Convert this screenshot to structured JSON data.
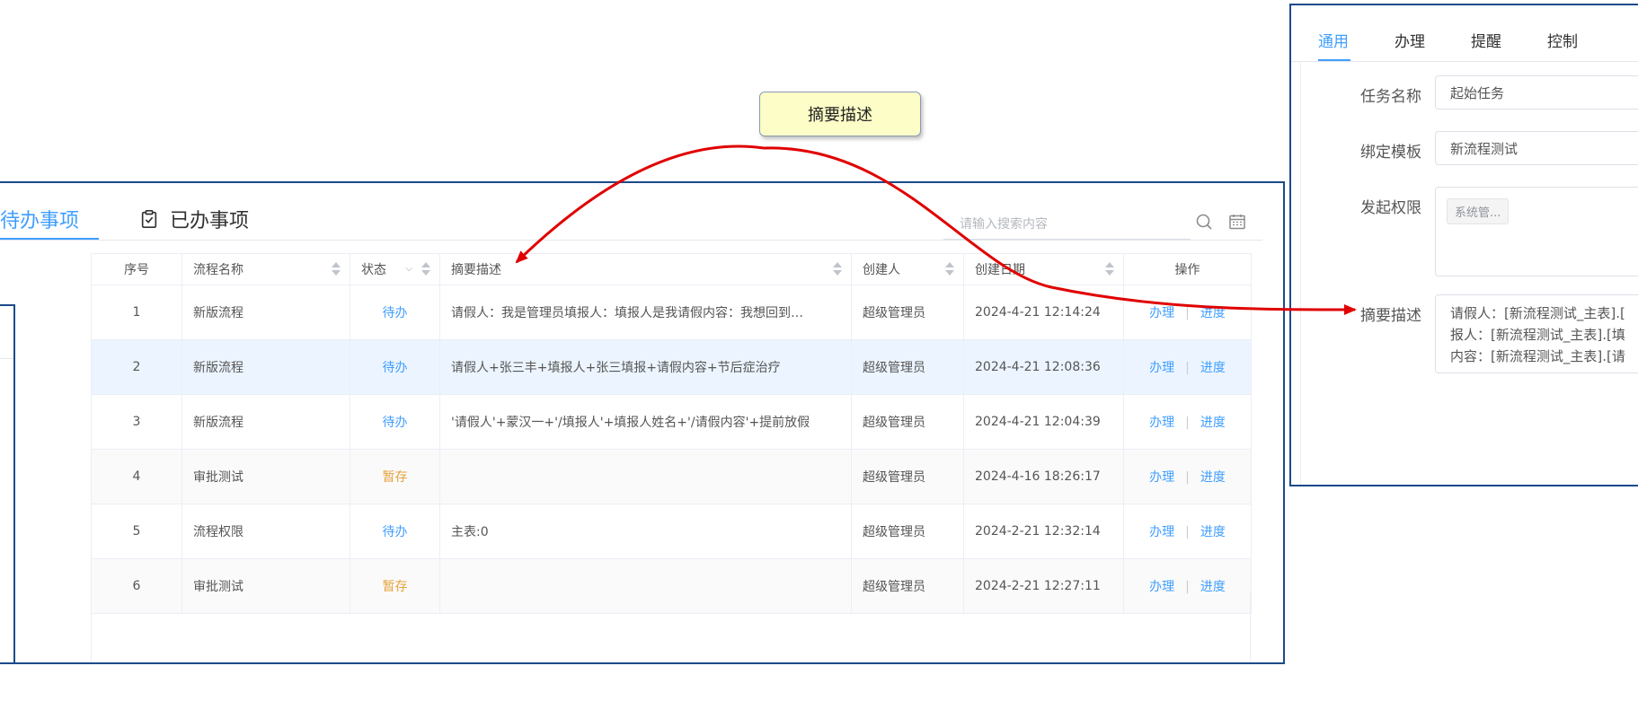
{
  "main": {
    "tab_pending": "待办事项",
    "tab_done": "已办事项",
    "search_placeholder": "请输入搜索内容",
    "columns": [
      "序号",
      "流程名称",
      "状态",
      "摘要描述",
      "创建人",
      "创建日期",
      "操作"
    ],
    "rows": [
      {
        "no": "1",
        "name": "新版流程",
        "status": "待办",
        "summary": "请假人：我是管理员填报人：填报人是我请假内容：我想回到…",
        "creator": "超级管理员",
        "date": "2024-4-21 12:14:24"
      },
      {
        "no": "2",
        "name": "新版流程",
        "status": "待办",
        "summary": "请假人+张三丰+填报人+张三填报+请假内容+节后症治疗",
        "creator": "超级管理员",
        "date": "2024-4-21 12:08:36"
      },
      {
        "no": "3",
        "name": "新版流程",
        "status": "待办",
        "summary": "'请假人'+蒙汉一+'/填报人'+填报人姓名+'/请假内容'+提前放假",
        "creator": "超级管理员",
        "date": "2024-4-21 12:04:39"
      },
      {
        "no": "4",
        "name": "审批测试",
        "status": "暂存",
        "summary": "",
        "creator": "超级管理员",
        "date": "2024-4-16 18:26:17"
      },
      {
        "no": "5",
        "name": "流程权限",
        "status": "待办",
        "summary": "主表:0",
        "creator": "超级管理员",
        "date": "2024-2-21 12:32:14"
      },
      {
        "no": "6",
        "name": "审批测试",
        "status": "暂存",
        "summary": "",
        "creator": "超级管理员",
        "date": "2024-2-21 12:27:11"
      }
    ],
    "op_handle": "办理",
    "op_progress": "进度",
    "op_separator": "|"
  },
  "callout": {
    "label": "摘要描述"
  },
  "right": {
    "tabs": [
      "通用",
      "办理",
      "提醒",
      "控制"
    ],
    "task_name_label": "任务名称",
    "task_name_value": "起始任务",
    "template_label": "绑定模板",
    "template_value": "新流程测试",
    "permission_label": "发起权限",
    "permission_tag": "系统管...",
    "summary_label": "摘要描述",
    "summary_lines": [
      "请假人：[新流程测试_主表].[",
      "报人：[新流程测试_主表].[填",
      "内容：[新流程测试_主表].[请"
    ]
  },
  "colors": {
    "accent": "#409eff",
    "draft": "#e6a23c",
    "frame": "#1c4a8a",
    "arrow": "#e00000",
    "callout_bg": "#fdfdc8"
  }
}
